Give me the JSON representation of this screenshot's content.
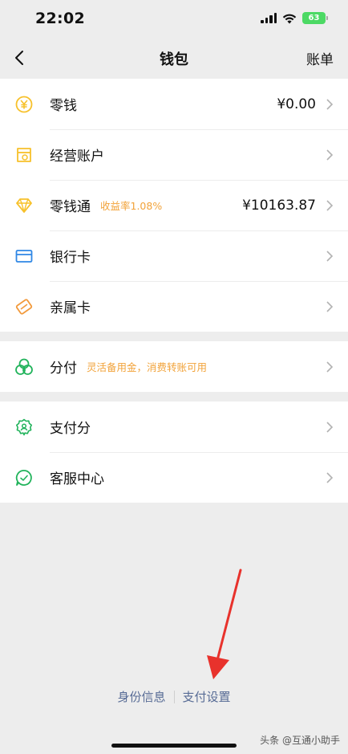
{
  "status": {
    "time": "22:02",
    "battery": "63"
  },
  "nav": {
    "title": "钱包",
    "right": "账单"
  },
  "group1": [
    {
      "label": "零钱",
      "value": "¥0.00",
      "icon": "coin-icon",
      "color": "#f7c12b"
    },
    {
      "label": "经营账户",
      "icon": "business-account-icon",
      "color": "#f7c12b"
    },
    {
      "label": "零钱通",
      "tag": "收益率1.08%",
      "value": "¥10163.87",
      "icon": "diamond-icon",
      "color": "#f7c12b"
    },
    {
      "label": "银行卡",
      "icon": "bank-card-icon",
      "color": "#2f87e5"
    },
    {
      "label": "亲属卡",
      "icon": "family-card-icon",
      "color": "#f29a3c"
    }
  ],
  "group2": [
    {
      "label": "分付",
      "tag": "灵活备用金，消费转账可用",
      "icon": "fenfu-icon",
      "color": "#21b35b"
    }
  ],
  "group3": [
    {
      "label": "支付分",
      "icon": "pay-score-icon",
      "color": "#21b35b"
    },
    {
      "label": "客服中心",
      "icon": "customer-service-icon",
      "color": "#21b35b"
    }
  ],
  "footer": {
    "identity": "身份信息",
    "pay_settings": "支付设置"
  },
  "watermark": "头条 @互通小助手",
  "colors": {
    "tag": "#f2a33a",
    "link": "#576b95",
    "annotation_arrow": "#e8322c"
  }
}
